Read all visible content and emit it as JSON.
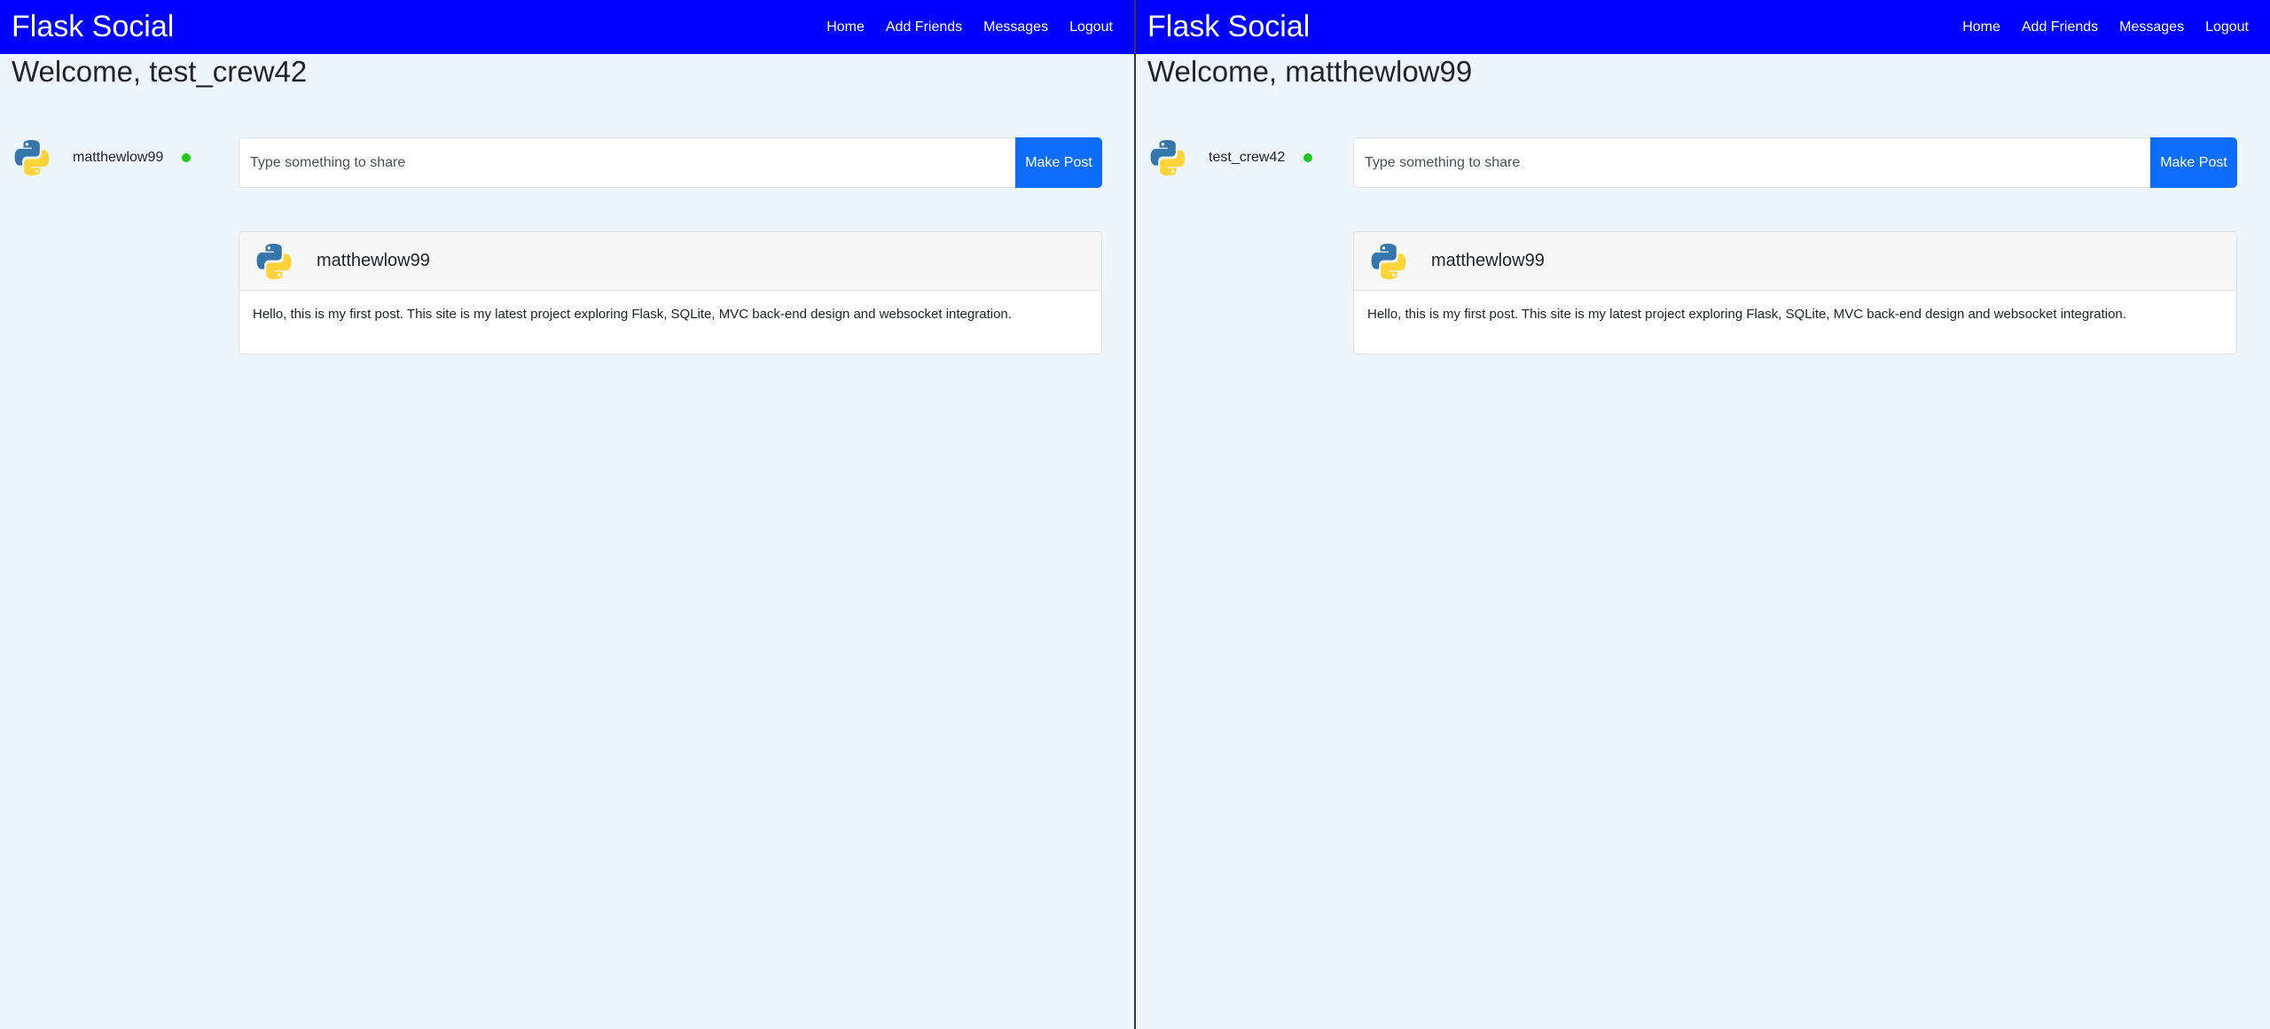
{
  "windows": [
    {
      "brand": "Flask Social",
      "nav": [
        "Home",
        "Add Friends",
        "Messages",
        "Logout"
      ],
      "welcome": "Welcome, test_crew42",
      "friend": {
        "name": "matthewlow99",
        "status": "online"
      },
      "post_form": {
        "placeholder": "Type something to share",
        "value": "",
        "button_label": "Make Post"
      },
      "posts": [
        {
          "author": "matthewlow99",
          "body": "Hello, this is my first post. This site is my latest project exploring Flask, SQLite, MVC back-end design and websocket integration."
        }
      ]
    },
    {
      "brand": "Flask Social",
      "nav": [
        "Home",
        "Add Friends",
        "Messages",
        "Logout"
      ],
      "welcome": "Welcome, matthewlow99",
      "friend": {
        "name": "test_crew42",
        "status": "online"
      },
      "post_form": {
        "placeholder": "Type something to share",
        "value": "",
        "button_label": "Make Post"
      },
      "posts": [
        {
          "author": "matthewlow99",
          "body": "Hello, this is my first post. This site is my latest project exploring Flask, SQLite, MVC back-end design and websocket integration."
        }
      ]
    }
  ],
  "icons": {
    "avatar": "python-logo-icon",
    "status": "online-status-dot"
  },
  "colors": {
    "navbar": "#0000ff",
    "page_background": "#eef6fd",
    "primary_button": "#0d6efd",
    "online": "#1ec91e"
  }
}
